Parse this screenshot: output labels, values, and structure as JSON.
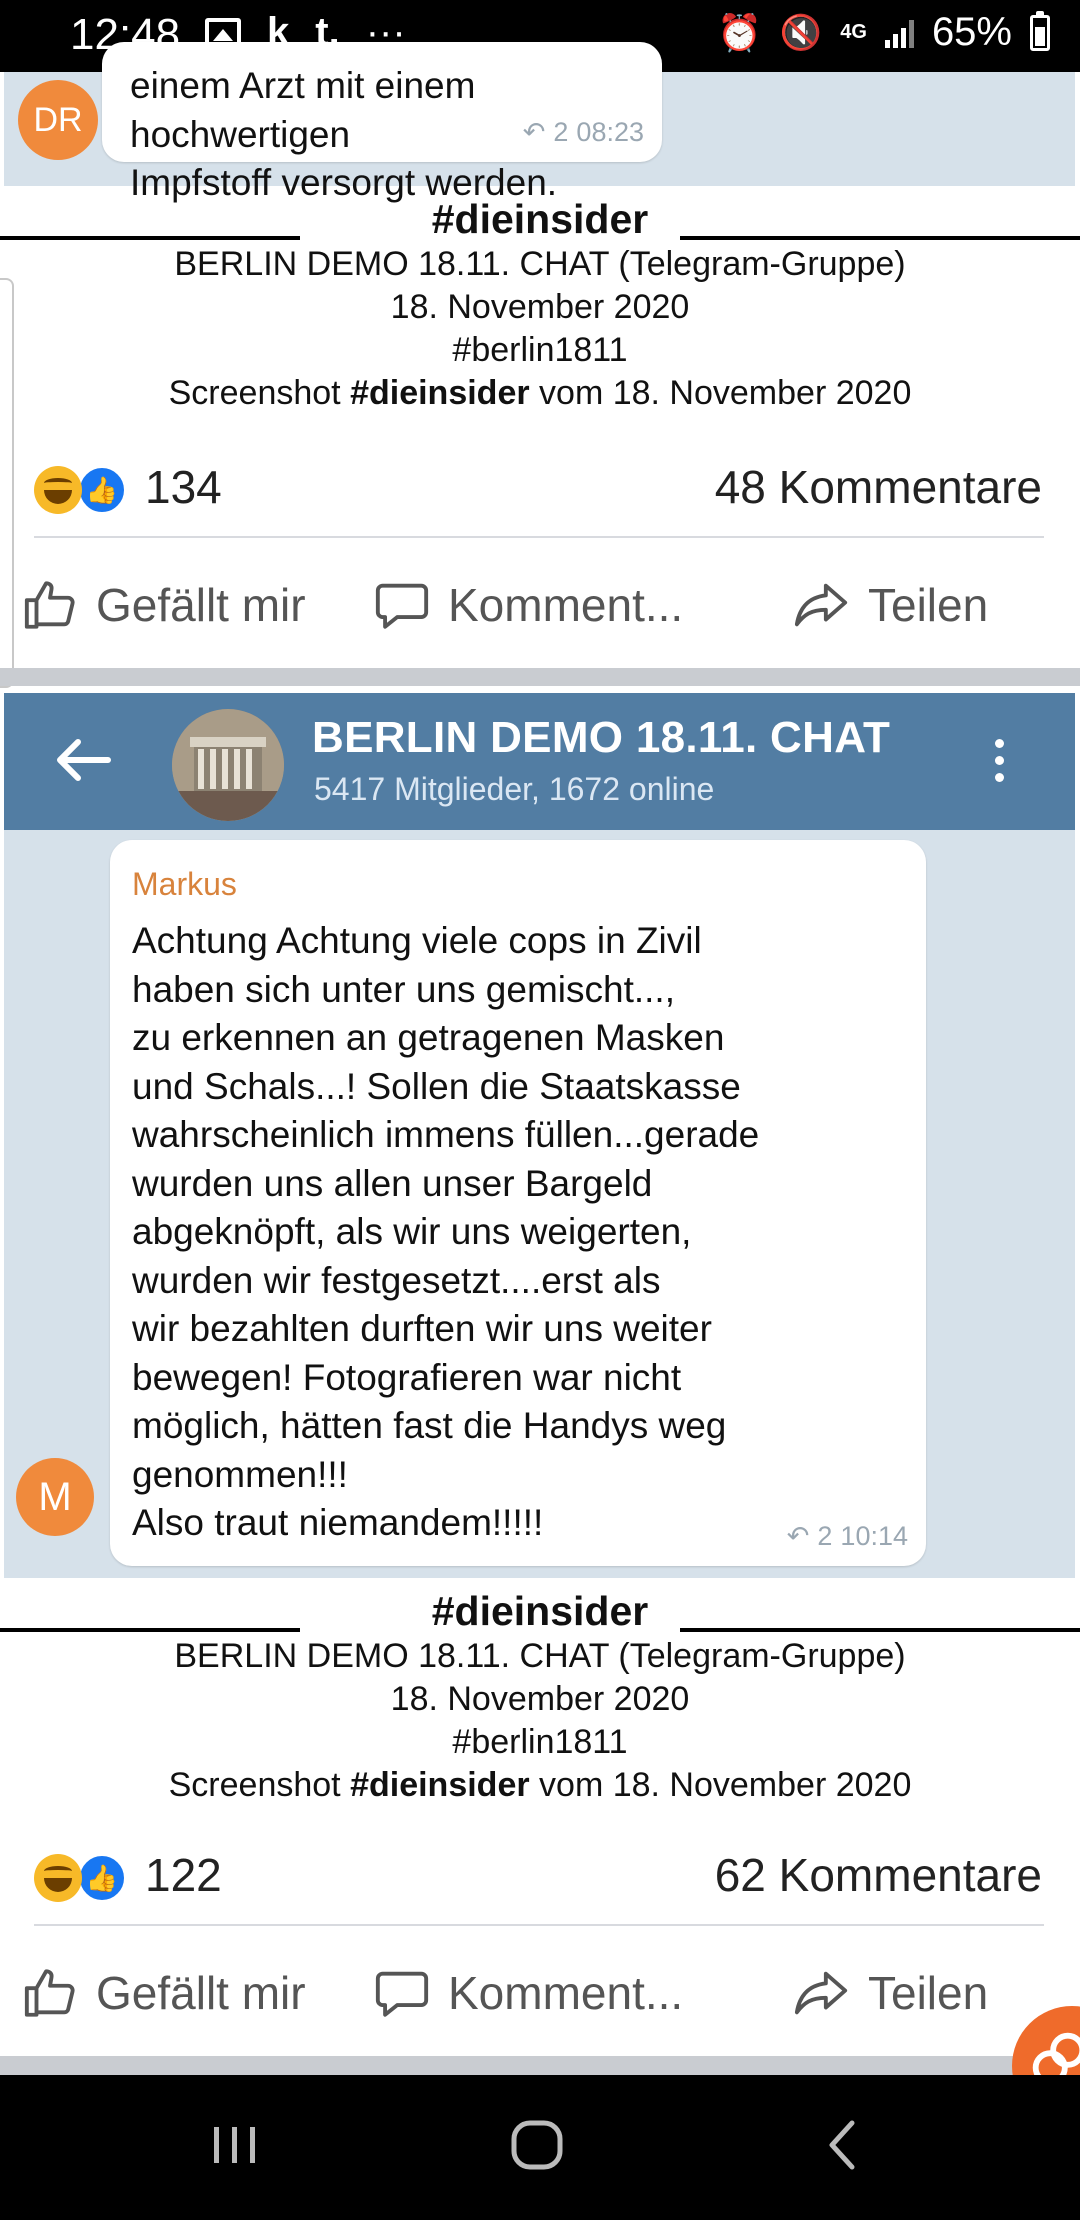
{
  "status_bar": {
    "time": "12:48",
    "notif_k": "k",
    "notif_t": "t.",
    "more_dots": "···",
    "network": "4G",
    "battery": "65%"
  },
  "top_message": {
    "avatar_initials": "DR",
    "line1": "einem Arzt mit einem hochwertigen",
    "line2": "Impfstoff versorgt werden.",
    "replies": "2",
    "time": "08:23"
  },
  "posts": [
    {
      "hashtag": "#dieinsider",
      "caption_line1": "BERLIN DEMO 18.11. CHAT (Telegram-Gruppe)",
      "caption_line2": "18. November 2020",
      "caption_line3": "#berlin1811",
      "caption_prefix": "Screenshot",
      "caption_bold": "#dieinsider",
      "caption_suffix": "vom 18. November 2020",
      "reaction_count": "134",
      "comments": "48 Kommentare"
    },
    {
      "hashtag": "#dieinsider",
      "caption_line1": "BERLIN DEMO 18.11. CHAT (Telegram-Gruppe)",
      "caption_line2": "18. November 2020",
      "caption_line3": "#berlin1811",
      "caption_prefix": "Screenshot",
      "caption_bold": "#dieinsider",
      "caption_suffix": "vom 18. November 2020",
      "reaction_count": "122",
      "comments": "62 Kommentare"
    }
  ],
  "actions": {
    "like": "Gefällt mir",
    "comment": "Komment...",
    "share": "Teilen"
  },
  "telegram": {
    "title": "BERLIN DEMO 18.11. CHAT",
    "subtitle": "5417 Mitglieder, 1672 online",
    "sender": "Markus",
    "avatar_initial": "M",
    "message_lines": [
      "Achtung Achtung viele cops in Zivil",
      "haben sich unter uns gemischt...,",
      "zu erkennen an getragenen Masken",
      "und Schals...! Sollen die Staatskasse",
      "wahrscheinlich immens füllen...gerade",
      "wurden uns allen unser Bargeld",
      "abgeknöpft, als wir uns weigerten,",
      "wurden wir festgesetzt....erst als",
      "wir bezahlten durften wir uns weiter",
      "bewegen! Fotografieren war nicht",
      "möglich, hätten fast die Handys weg",
      "genommen!!!",
      "Also traut niemandem!!!!!"
    ],
    "replies": "2",
    "time": "10:14"
  },
  "colors": {
    "telegram_header": "#527da3",
    "telegram_bg": "#d6e1ea",
    "avatar_orange": "#f08a3c",
    "like_blue": "#1877f2",
    "haha_yellow": "#f7b928"
  }
}
